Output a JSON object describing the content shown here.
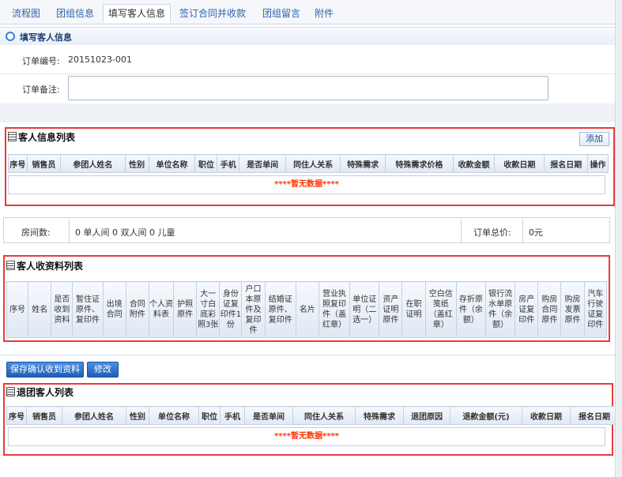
{
  "tabs": [
    {
      "label": "流程图"
    },
    {
      "label": "团组信息"
    },
    {
      "label": "填写客人信息"
    },
    {
      "label": "签订合同并收款"
    },
    {
      "label": "团组留言"
    },
    {
      "label": "附件"
    }
  ],
  "section_title": "填写客人信息",
  "form": {
    "order_no_label": "订单编号:",
    "order_no_value": "20151023-001",
    "remark_label": "订单备注:",
    "remark_value": ""
  },
  "guest_list": {
    "title": "客人信息列表",
    "add_label": "添加",
    "columns": [
      "序号",
      "销售员",
      "参团人姓名",
      "性别",
      "单位名称",
      "职位",
      "手机",
      "是否单间",
      "同住人关系",
      "特殊需求",
      "特殊需求价格",
      "收款金额",
      "收款日期",
      "报名日期",
      "操作"
    ],
    "empty_text": "****暂无数据****"
  },
  "room": {
    "count_label": "房间数:",
    "count_value": "0 单人间 0 双人间 0 儿童",
    "total_label": "订单总价:",
    "total_value": "0元"
  },
  "docs_list": {
    "title": "客人收资料列表",
    "columns": [
      "序号",
      "姓名",
      "是否收到资料",
      "暂住证原件、复印件",
      "出境合同",
      "合同附件",
      "个人资料表",
      "护照原件",
      "大一寸白底彩照3张",
      "身份证复印件1份",
      "户口本原件及复印件",
      "结婚证原件、复印件",
      "名片",
      "营业执照复印件（盖红章）",
      "单位证明（二选一）",
      "资产证明原件",
      "在职证明",
      "空白信笺纸（盖红章）",
      "存折原件（余额）",
      "银行流水单原件（余额）",
      "房产证复印件",
      "购房合同原件",
      "购房发票原件",
      "汽车行驶证复印件"
    ]
  },
  "buttons": {
    "save_label": "保存确认收到资料",
    "edit_label": "修改"
  },
  "refund_list": {
    "title": "退团客人列表",
    "columns": [
      "序号",
      "销售员",
      "参团人姓名",
      "性别",
      "单位名称",
      "职位",
      "手机",
      "是否单间",
      "同住人关系",
      "特殊需求",
      "退团原因",
      "退款金额(元)",
      "收款日期",
      "报名日期"
    ],
    "empty_text": "****暂无数据****"
  }
}
